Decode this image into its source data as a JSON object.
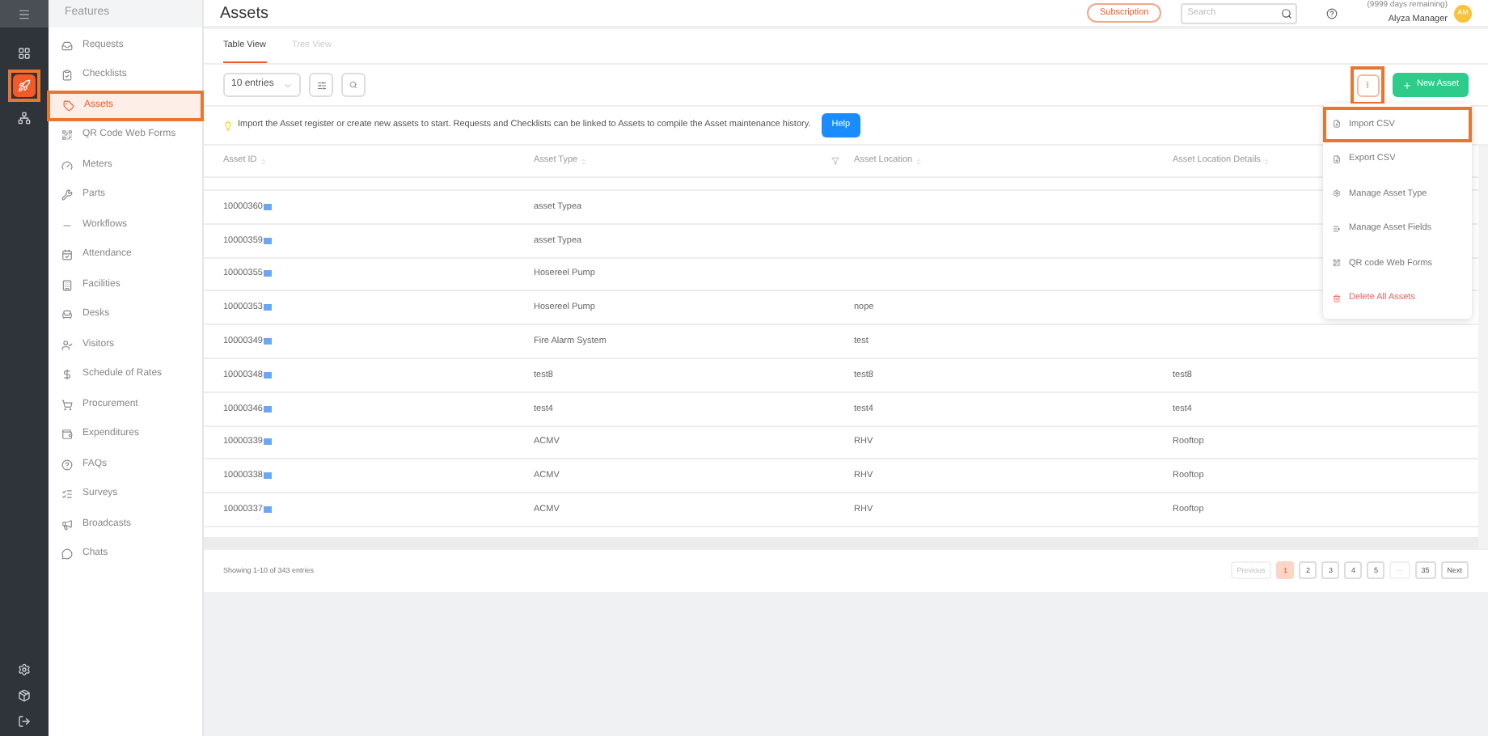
{
  "rail": {
    "items": [
      {
        "kind": "grid",
        "highlighted": false
      },
      {
        "kind": "app",
        "highlighted": true
      },
      {
        "kind": "tree",
        "highlighted": false
      }
    ],
    "bottom": [
      {
        "kind": "gear"
      },
      {
        "kind": "box"
      },
      {
        "kind": "exit"
      }
    ]
  },
  "sidebar": {
    "title": "Features",
    "items": [
      {
        "label": "Requests",
        "selected": false,
        "highlighted": false
      },
      {
        "label": "Checklists",
        "selected": false,
        "highlighted": false
      },
      {
        "label": "Assets",
        "selected": true,
        "highlighted": true
      },
      {
        "label": "QR Code Web Forms",
        "selected": false,
        "highlighted": false
      },
      {
        "label": "Meters",
        "selected": false,
        "highlighted": false
      },
      {
        "label": "Parts",
        "selected": false,
        "highlighted": false
      },
      {
        "label": "Workflows",
        "selected": false,
        "highlighted": false
      },
      {
        "label": "Attendance",
        "selected": false,
        "highlighted": false
      },
      {
        "label": "Facilities",
        "selected": false,
        "highlighted": false
      },
      {
        "label": "Desks",
        "selected": false,
        "highlighted": false
      },
      {
        "label": "Visitors",
        "selected": false,
        "highlighted": false
      },
      {
        "label": "Schedule of Rates",
        "selected": false,
        "highlighted": false
      },
      {
        "label": "Procurement",
        "selected": false,
        "highlighted": false
      },
      {
        "label": "Expenditures",
        "selected": false,
        "highlighted": false
      },
      {
        "label": "FAQs",
        "selected": false,
        "highlighted": false
      },
      {
        "label": "Surveys",
        "selected": false,
        "highlighted": false
      },
      {
        "label": "Broadcasts",
        "selected": false,
        "highlighted": false
      },
      {
        "label": "Chats",
        "selected": false,
        "highlighted": false
      }
    ]
  },
  "header": {
    "title": "Assets",
    "subscription": "Subscription",
    "search": {
      "placeholder": "Search"
    },
    "plan": "(9999 days remaining)",
    "user": "Alyza Manager",
    "avatar": "AM"
  },
  "tabs": [
    {
      "label": "Table View",
      "selected": true
    },
    {
      "label": "Tree View",
      "selected": false
    }
  ],
  "toolbar": {
    "entries": "10 entries",
    "more_highlighted": true,
    "new_button": "New Asset"
  },
  "banner": {
    "text": "Import the Asset register or create new assets to start. Requests and Checklists can be linked to Assets to compile the Asset maintenance history.",
    "help": "Help"
  },
  "table": {
    "columns": [
      "Asset ID",
      "Asset Type",
      "Asset Location",
      "Asset Location Details"
    ],
    "rows": [
      [
        "10000360",
        "asset Typea",
        "",
        ""
      ],
      [
        "10000359",
        "asset Typea",
        "",
        ""
      ],
      [
        "10000355",
        "Hosereel Pump",
        "",
        ""
      ],
      [
        "10000353",
        "Hosereel Pump",
        "nope",
        ""
      ],
      [
        "10000349",
        "Fire Alarm System",
        "test",
        ""
      ],
      [
        "10000348",
        "test8",
        "test8",
        "test8"
      ],
      [
        "10000346",
        "test4",
        "test4",
        "test4"
      ],
      [
        "10000339",
        "ACMV",
        "RHV",
        "Rooftop"
      ],
      [
        "10000338",
        "ACMV",
        "RHV",
        "Rooftop"
      ],
      [
        "10000337",
        "ACMV",
        "RHV",
        "Rooftop"
      ]
    ]
  },
  "menu": [
    {
      "label": "Import CSV",
      "kind": "import",
      "highlighted": true
    },
    {
      "label": "Export CSV",
      "kind": "export",
      "highlighted": false
    },
    {
      "label": "Manage Asset Type",
      "kind": "gear",
      "highlighted": false
    },
    {
      "label": "Manage Asset Fields",
      "kind": "fields",
      "highlighted": false
    },
    {
      "label": "QR code Web Forms",
      "kind": "qr",
      "highlighted": false
    },
    {
      "label": "Delete All Assets",
      "kind": "danger",
      "highlighted": false
    }
  ],
  "footer": {
    "summary": "Showing 1-10 of 343 entries",
    "pages": [
      {
        "label": "Previous",
        "selected": false,
        "disabled": true
      },
      {
        "label": "1",
        "selected": true,
        "disabled": false
      },
      {
        "label": "2",
        "selected": false,
        "disabled": false
      },
      {
        "label": "3",
        "selected": false,
        "disabled": false
      },
      {
        "label": "4",
        "selected": false,
        "disabled": false
      },
      {
        "label": "5",
        "selected": false,
        "disabled": false
      },
      {
        "label": "···",
        "selected": false,
        "disabled": true
      },
      {
        "label": "35",
        "selected": false,
        "disabled": false
      },
      {
        "label": "Next",
        "selected": false,
        "disabled": false
      }
    ]
  }
}
